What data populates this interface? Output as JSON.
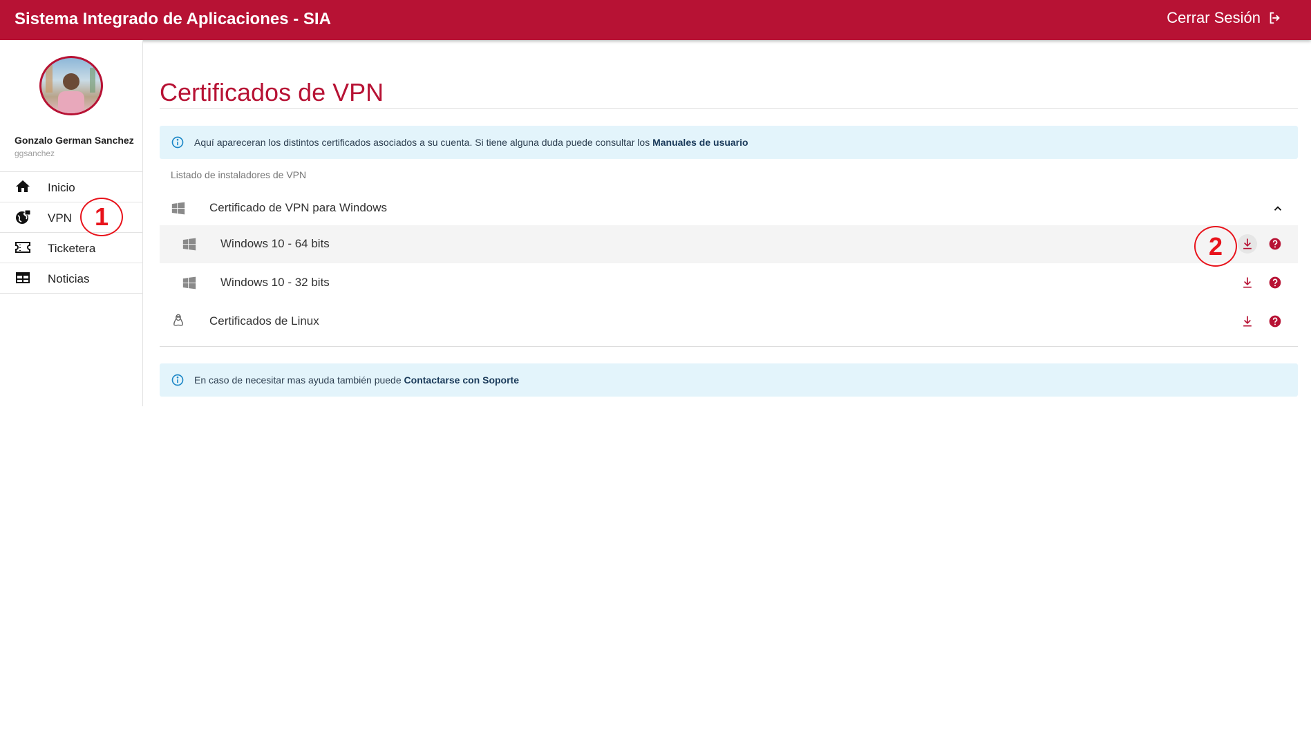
{
  "header": {
    "title": "Sistema Integrado de Aplicaciones - SIA",
    "logout_label": "Cerrar Sesión"
  },
  "user": {
    "name": "Gonzalo German Sanchez",
    "login": "ggsanchez"
  },
  "nav": [
    {
      "label": "Inicio",
      "icon": "home-icon"
    },
    {
      "label": "VPN",
      "icon": "globe-lock-icon"
    },
    {
      "label": "Ticketera",
      "icon": "ticket-icon"
    },
    {
      "label": "Noticias",
      "icon": "newspaper-icon"
    }
  ],
  "page": {
    "title": "Certificados de VPN",
    "info_text": "Aquí apareceran los distintos certificados asociados a su cuenta. Si tiene alguna duda puede consultar los ",
    "info_link": "Manuales de usuario",
    "list_caption": "Listado de instaladores de VPN",
    "windows_group": "Certificado de VPN para Windows",
    "win64": "Windows 10 - 64 bits",
    "win32": "Windows 10 - 32 bits",
    "linux": "Certificados de Linux",
    "support_text": "En caso de necesitar mas ayuda también puede ",
    "support_link": "Contactarse con Soporte"
  },
  "annotations": [
    "1",
    "2"
  ],
  "colors": {
    "brand": "#b71234",
    "info_bg": "#e3f4fb",
    "annotation": "#e8131b"
  }
}
